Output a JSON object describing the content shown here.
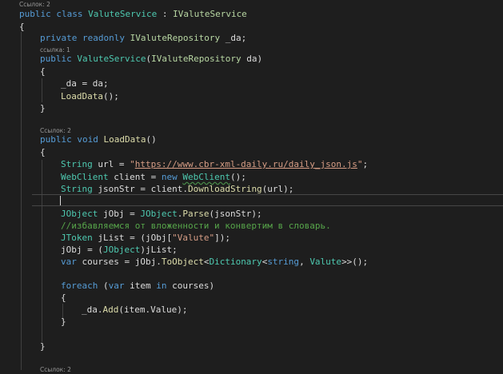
{
  "references": {
    "class_refs": "Ссылок: 2",
    "ctor_refs": "ссылка: 1",
    "method_refs": "Ссылок: 2",
    "bottom_refs": "Ссылок: 2"
  },
  "code": {
    "class_public": "public",
    "class_class": "class",
    "class_name": "ValuteService",
    "class_colon": " : ",
    "class_base": "IValuteService",
    "brace_open": "{",
    "brace_close": "}",
    "field_private": "private",
    "field_readonly": "readonly",
    "field_type": "IValuteRepository",
    "field_name": " _da;",
    "ctor_public": "public",
    "ctor_name": "ValuteService",
    "ctor_paren_open": "(",
    "ctor_param_type": "IValuteRepository",
    "ctor_param_name": " da)",
    "ctor_assign": "_da = da;",
    "ctor_call": "LoadData",
    "ctor_call_end": "();",
    "method_public": "public",
    "method_void": "void",
    "method_name": "LoadData",
    "method_parens": "()",
    "url_type": "String",
    "url_decl": " url = ",
    "url_quote_open": "\"",
    "url_value": "https://www.cbr-xml-daily.ru/daily_json.js",
    "url_quote_close": "\"",
    "url_end": ";",
    "wc_type": "WebClient",
    "wc_decl": " client = ",
    "wc_new": "new",
    "wc_ctor": "WebClient",
    "wc_end": "();",
    "json_type": "String",
    "json_decl": " jsonStr = client.",
    "json_method": "DownloadString",
    "json_end": "(url);",
    "jobj_type": "JObject",
    "jobj_decl": " jObj = ",
    "jobj_class": "JObject",
    "jobj_dot": ".",
    "jobj_method": "Parse",
    "jobj_end": "(jsonStr);",
    "comment": "//избавляемся от вложенности и конвертим в словарь.",
    "jtoken_type": "JToken",
    "jtoken_decl": " jList = (jObj[",
    "jtoken_key": "\"Valute\"",
    "jtoken_end": "]);",
    "cast_start": "jObj = (",
    "cast_type": "JObject",
    "cast_end": ")jList;",
    "var_kw": "var",
    "courses_decl": " courses = jObj.",
    "to_object": "ToObject",
    "generic_open": "<",
    "dict_type": "Dictionary",
    "generic_open2": "<",
    "string_kw": "string",
    "generic_sep": ", ",
    "valute_type": "Valute",
    "courses_end": ">>();",
    "foreach_kw": "foreach",
    "foreach_paren": " (",
    "foreach_var": "var",
    "foreach_item": " item ",
    "foreach_in": "in",
    "foreach_end": " courses)",
    "add_prefix": "_da.",
    "add_method": "Add",
    "add_end": "(item.Value);"
  },
  "colors": {
    "background": "#1e1e1e",
    "keyword": "#569cd6",
    "type": "#4ec9b0",
    "interface": "#b8d7a3",
    "method": "#dcdcaa",
    "string": "#d69d85",
    "comment": "#57a64a",
    "text": "#dcdcdc"
  }
}
